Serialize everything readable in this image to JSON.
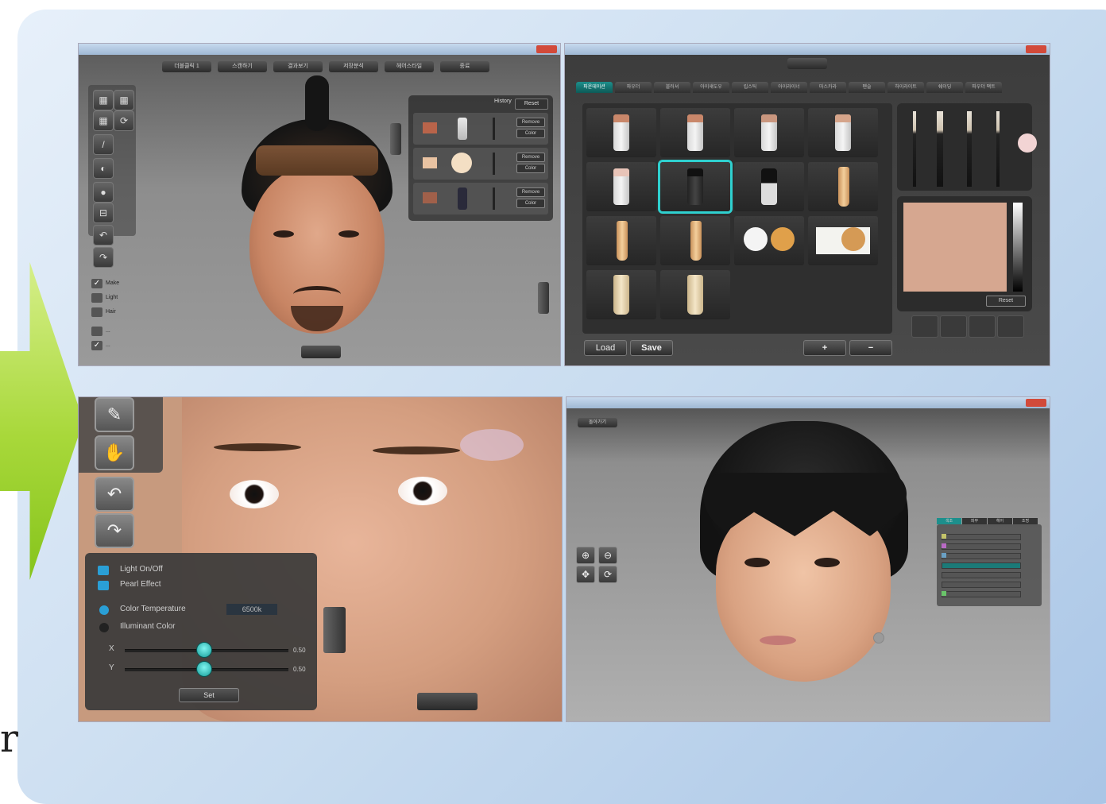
{
  "corner_text": "r",
  "panel_tl": {
    "menu": [
      "더블클릭 1",
      "스캔하기",
      "결과보기",
      "저장분석",
      "헤어스타일",
      "종료"
    ],
    "info_header": "History",
    "info_reset": "Reset",
    "info_rows": [
      {
        "swatch": "#b9644a",
        "btn1": "Remove",
        "btn2": "Color"
      },
      {
        "swatch": "#e9c3a2",
        "btn1": "Remove",
        "btn2": "Color"
      },
      {
        "swatch": "#a0604a",
        "btn1": "Remove",
        "btn2": "Color"
      }
    ],
    "checks": [
      {
        "label": "Make",
        "checked": true
      },
      {
        "label": "Light",
        "checked": false
      },
      {
        "label": "Hair",
        "checked": false
      },
      {
        "label": "...",
        "checked": false
      },
      {
        "label": "...",
        "checked": true
      }
    ]
  },
  "panel_tr": {
    "tabs": [
      "파운데이션",
      "파우더",
      "블러셔",
      "아이섀도우",
      "립스틱",
      "아이라이너",
      "마스카라",
      "펜슬",
      "하이라이트",
      "쉐이딩",
      "파우더 팩트"
    ],
    "active_tab": 0,
    "reset_label": "Reset",
    "load_label": "Load",
    "save_label": "Save",
    "plus_label": "+",
    "minus_label": "−",
    "color_swatch": "#d6a790"
  },
  "panel_bl": {
    "light_onoff": "Light On/Off",
    "pearl_effect": "Pearl Effect",
    "color_temp_label": "Color Temperature",
    "color_temp_value": "6500k",
    "illuminant_label": "Illuminant Color",
    "x_label": "X",
    "y_label": "Y",
    "x_value": "0.50",
    "y_value": "0.50",
    "set_label": "Set"
  },
  "panel_br": {
    "top_button": "돌아가기",
    "right_tabs": [
      "색조",
      "피부",
      "헤어",
      "조명"
    ]
  },
  "colors": {
    "accent_teal": "#2fd0cf",
    "arrow_green": "#a8d83a"
  }
}
